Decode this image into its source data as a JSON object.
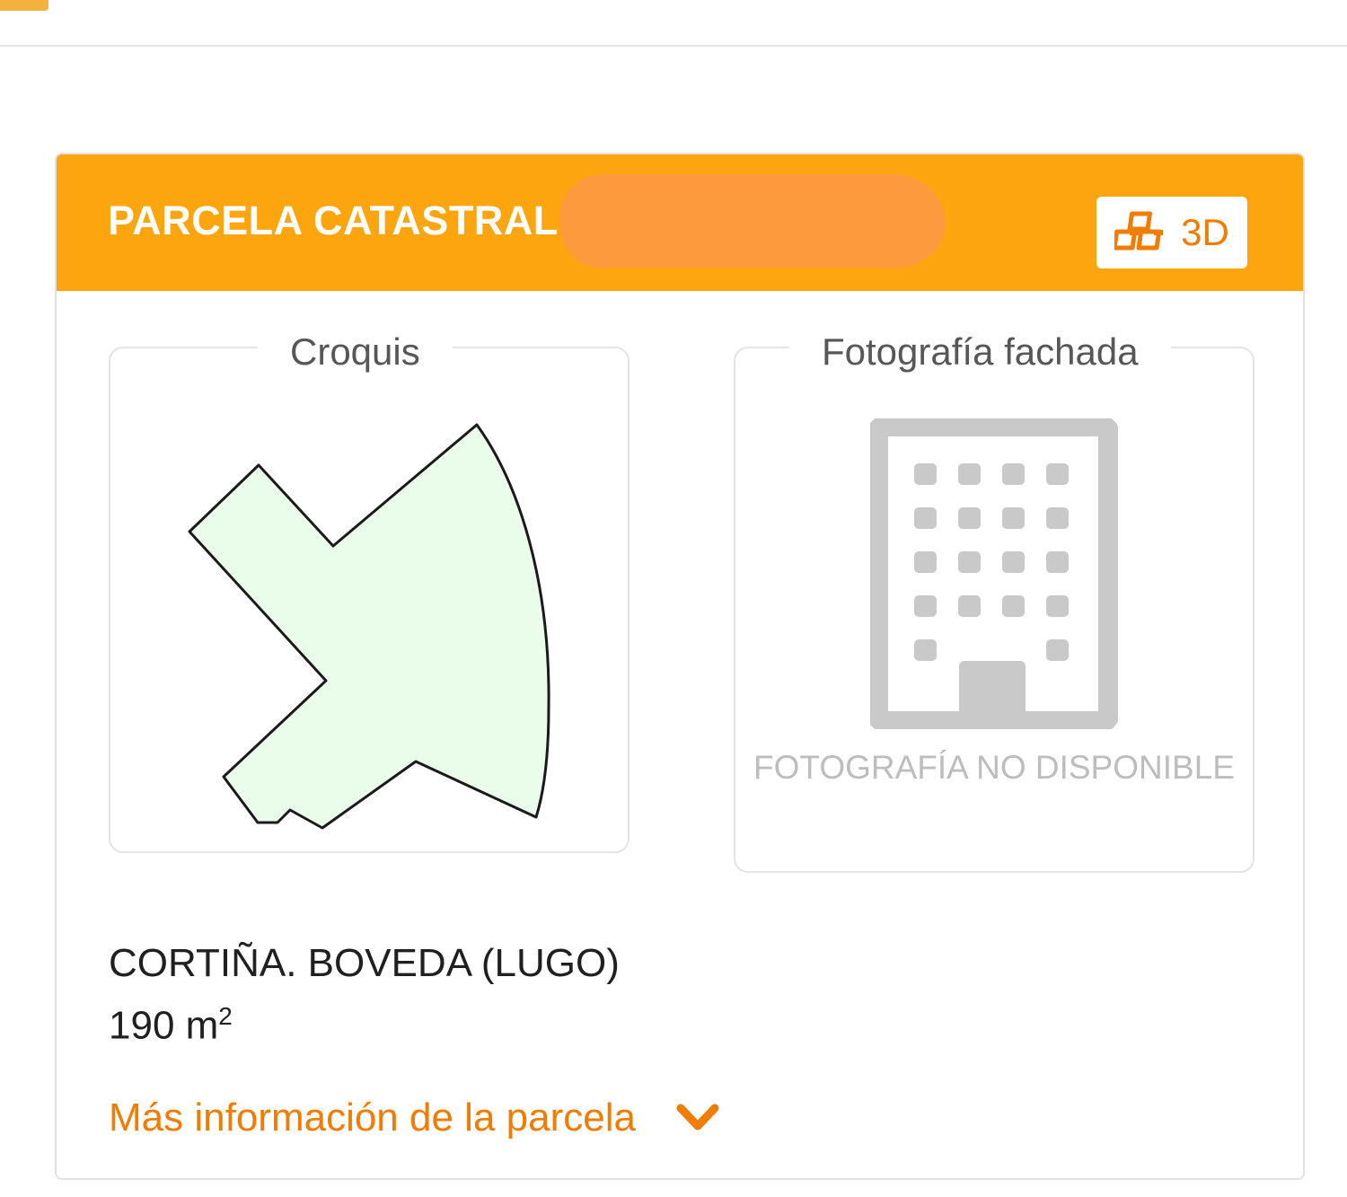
{
  "header": {
    "title": "PARCELA CATASTRAL",
    "btn_3d_label": "3D"
  },
  "croquis": {
    "legend": "Croquis"
  },
  "fachada": {
    "legend": "Fotografía fachada",
    "not_available": "FOTOGRAFÍA NO DISPONIBLE"
  },
  "parcel": {
    "address": "CORTIÑA. BOVEDA (LUGO)",
    "area_value": "190 m",
    "area_exp": "2"
  },
  "more_info": {
    "label": "Más información de la parcela"
  },
  "colors": {
    "header_bg": "#fca50f",
    "accent": "#f07c00",
    "sketch_fill": "#eafcea"
  },
  "icons": {
    "cubes": "cubes-icon",
    "building": "building-icon",
    "chevron": "chevron-down-icon"
  }
}
